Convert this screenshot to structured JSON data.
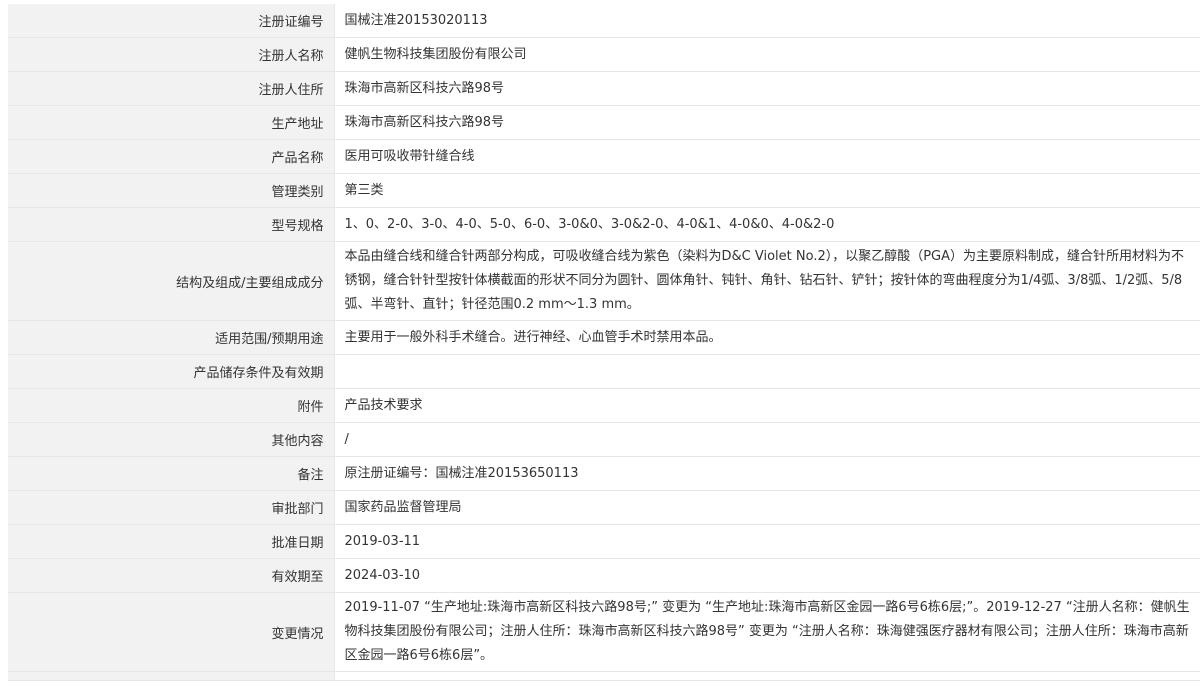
{
  "rows": [
    {
      "label": "注册证编号",
      "value": "国械注准20153020113"
    },
    {
      "label": "注册人名称",
      "value": "健帆生物科技集团股份有限公司"
    },
    {
      "label": "注册人住所",
      "value": "珠海市高新区科技六路98号"
    },
    {
      "label": "生产地址",
      "value": "珠海市高新区科技六路98号"
    },
    {
      "label": "产品名称",
      "value": "医用可吸收带针缝合线"
    },
    {
      "label": "管理类别",
      "value": "第三类"
    },
    {
      "label": "型号规格",
      "value": "1、0、2-0、3-0、4-0、5-0、6-0、3-0&0、3-0&2-0、4-0&1、4-0&0、4-0&2-0"
    },
    {
      "label": "结构及组成/主要组成成分",
      "value": "本品由缝合线和缝合针两部分构成，可吸收缝合线为紫色（染料为D&C Violet No.2），以聚乙醇酸（PGA）为主要原料制成，缝合针所用材料为不锈钢，缝合针针型按针体横截面的形状不同分为圆针、圆体角针、钝针、角针、钻石针、铲针；按针体的弯曲程度分为1/4弧、3/8弧、1/2弧、5/8弧、半弯针、直针；针径范围0.2 mm～1.3 mm。"
    },
    {
      "label": "适用范围/预期用途",
      "value": "主要用于一般外科手术缝合。进行神经、心血管手术时禁用本品。"
    },
    {
      "label": "产品储存条件及有效期",
      "value": ""
    },
    {
      "label": "附件",
      "value": "产品技术要求"
    },
    {
      "label": "其他内容",
      "value": "/"
    },
    {
      "label": "备注",
      "value": "原注册证编号：国械注准20153650113"
    },
    {
      "label": "审批部门",
      "value": "国家药品监督管理局"
    },
    {
      "label": "批准日期",
      "value": "2019-03-11"
    },
    {
      "label": "有效期至",
      "value": "2024-03-10"
    },
    {
      "label": "变更情况",
      "value": "2019-11-07 “生产地址:珠海市高新区科技六路98号;” 变更为 “生产地址:珠海市高新区金园一路6号6栋6层;”。2019-12-27 “注册人名称：健帆生物科技集团股份有限公司；注册人住所：珠海市高新区科技六路98号” 变更为 “注册人名称：珠海健强医疗器材有限公司；注册人住所：珠海市高新区金园一路6号6栋6层”。"
    }
  ]
}
